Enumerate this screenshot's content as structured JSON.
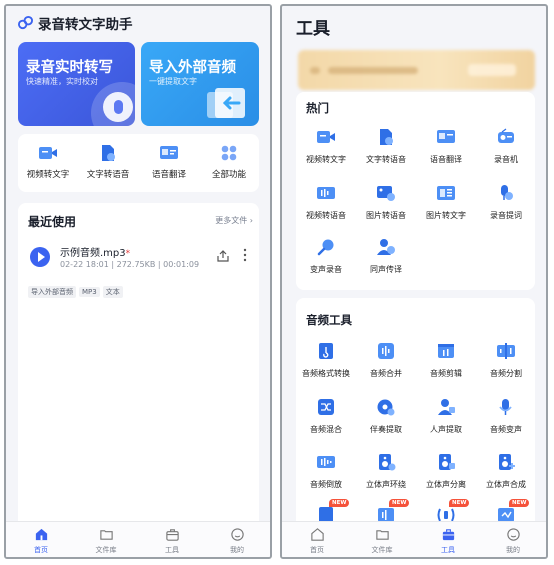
{
  "home": {
    "app_title": "录音转文字助手",
    "banner_left": {
      "title": "录音实时转写",
      "subtitle": "快速精准，实时校对"
    },
    "banner_right": {
      "title": "导入外部音频",
      "subtitle": "一键提取文字"
    },
    "quick_actions": [
      {
        "label": "视频转文字",
        "icon": "video-icon"
      },
      {
        "label": "文字转语音",
        "icon": "document-audio-icon"
      },
      {
        "label": "语音翻译",
        "icon": "translate-icon"
      },
      {
        "label": "全部功能",
        "icon": "grid-icon"
      }
    ],
    "recent": {
      "title": "最近使用",
      "more_label": "更多文件 ›",
      "file": {
        "name": "示例音频.mp3",
        "marker": "*",
        "meta": "02-22 18:01 | 272.75KB | 00:01:09",
        "tags": [
          "导入外部音频",
          "MP3",
          "文本"
        ]
      }
    },
    "tabbar": [
      {
        "label": "首页",
        "active": true
      },
      {
        "label": "文件库",
        "active": false
      },
      {
        "label": "工具",
        "active": false
      },
      {
        "label": "我的",
        "active": false
      }
    ]
  },
  "tools": {
    "page_title": "工具",
    "hot": {
      "title": "热门",
      "items": [
        {
          "label": "视频转文字",
          "icon": "video-icon"
        },
        {
          "label": "文字转语音",
          "icon": "document-audio-icon"
        },
        {
          "label": "语音翻译",
          "icon": "translate-icon"
        },
        {
          "label": "录音机",
          "icon": "recorder-icon"
        },
        {
          "label": "视频转语音",
          "icon": "video-audio-icon"
        },
        {
          "label": "图片转语音",
          "icon": "image-audio-icon"
        },
        {
          "label": "图片转文字",
          "icon": "image-text-icon"
        },
        {
          "label": "录音提词",
          "icon": "teleprompter-icon"
        },
        {
          "label": "变声录音",
          "icon": "voice-change-icon"
        },
        {
          "label": "同声传译",
          "icon": "interpreter-icon"
        }
      ]
    },
    "audio": {
      "title": "音频工具",
      "items": [
        {
          "label": "音频格式转换",
          "icon": "format-convert-icon"
        },
        {
          "label": "音频合并",
          "icon": "audio-merge-icon"
        },
        {
          "label": "音频剪辑",
          "icon": "audio-cut-icon"
        },
        {
          "label": "音频分割",
          "icon": "audio-split-icon"
        },
        {
          "label": "音频混合",
          "icon": "audio-mix-icon"
        },
        {
          "label": "伴奏提取",
          "icon": "accompaniment-icon"
        },
        {
          "label": "人声提取",
          "icon": "vocal-extract-icon"
        },
        {
          "label": "音频变声",
          "icon": "audio-voice-change-icon"
        },
        {
          "label": "音频倒放",
          "icon": "audio-reverse-icon"
        },
        {
          "label": "立体声环绕",
          "icon": "stereo-surround-icon"
        },
        {
          "label": "立体声分离",
          "icon": "stereo-split-icon"
        },
        {
          "label": "立体声合成",
          "icon": "stereo-merge-icon"
        }
      ],
      "new_badge": "NEW"
    },
    "tabbar": [
      {
        "label": "首页",
        "active": false
      },
      {
        "label": "文件库",
        "active": false
      },
      {
        "label": "工具",
        "active": true
      },
      {
        "label": "我的",
        "active": false
      }
    ]
  },
  "colors": {
    "accent": "#3b63f0",
    "badge": "#f5523a",
    "promo": "#f3d8a8"
  }
}
